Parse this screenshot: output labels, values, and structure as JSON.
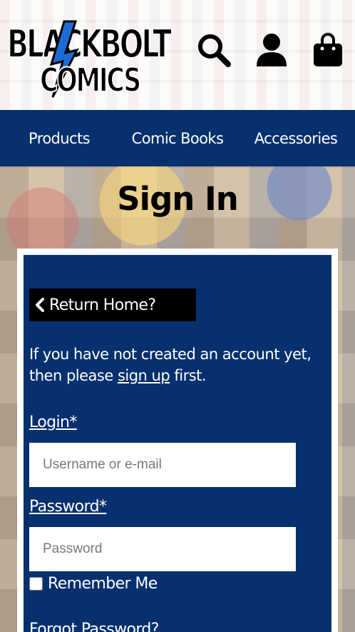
{
  "brand": {
    "logo_line1": "BLACKBOLT",
    "logo_line2": "COMICS",
    "accent_color": "#06306e",
    "logo_blue": "#1c6cd8"
  },
  "header": {
    "icons": [
      "search-icon",
      "account-icon",
      "shopping-bag-icon"
    ]
  },
  "nav": {
    "items": [
      {
        "label": "Products"
      },
      {
        "label": "Comic Books"
      },
      {
        "label": "Accessories"
      }
    ]
  },
  "page": {
    "title": "Sign In"
  },
  "signin": {
    "return_label": "Return Home?",
    "intro_before": "If you have not created an account yet, then please ",
    "signup_link": "sign up",
    "intro_after": " first.",
    "login_label": "Login*",
    "login_placeholder": "Username or e-mail",
    "password_label": "Password*",
    "password_placeholder": "Password",
    "remember_label": "Remember Me",
    "forgot_label": "Forgot Password?"
  }
}
